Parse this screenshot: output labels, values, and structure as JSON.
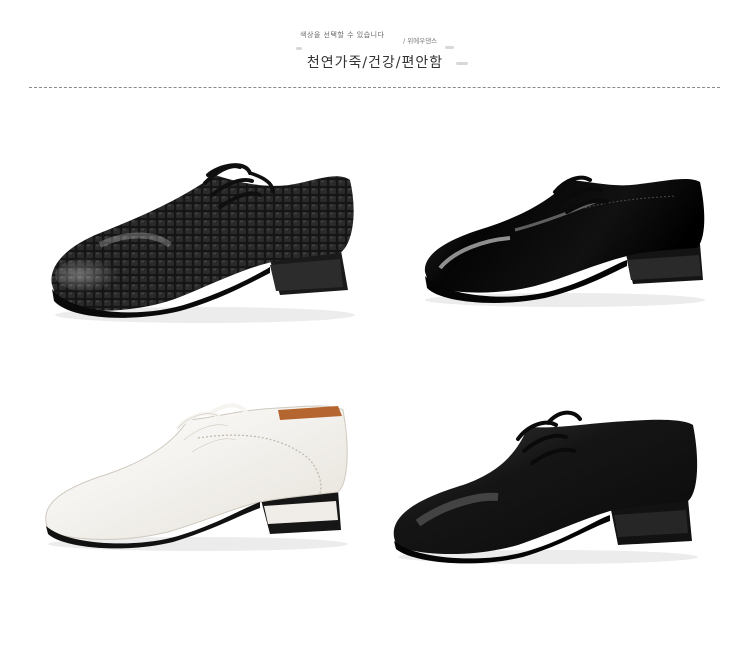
{
  "header": {
    "caption_small": "색상을 선택할 수 있습니다",
    "caption_brand": "/ 위에우댄스",
    "title": "천연가죽/건강/편안함"
  },
  "products": [
    {
      "name": "black-croc-dance-shoe",
      "color": "#141414"
    },
    {
      "name": "black-patent-dance-shoe",
      "color": "#0b0b0b"
    },
    {
      "name": "white-leather-dance-shoe",
      "color": "#f4f2ee"
    },
    {
      "name": "black-leather-dance-shoe",
      "color": "#151515"
    }
  ]
}
